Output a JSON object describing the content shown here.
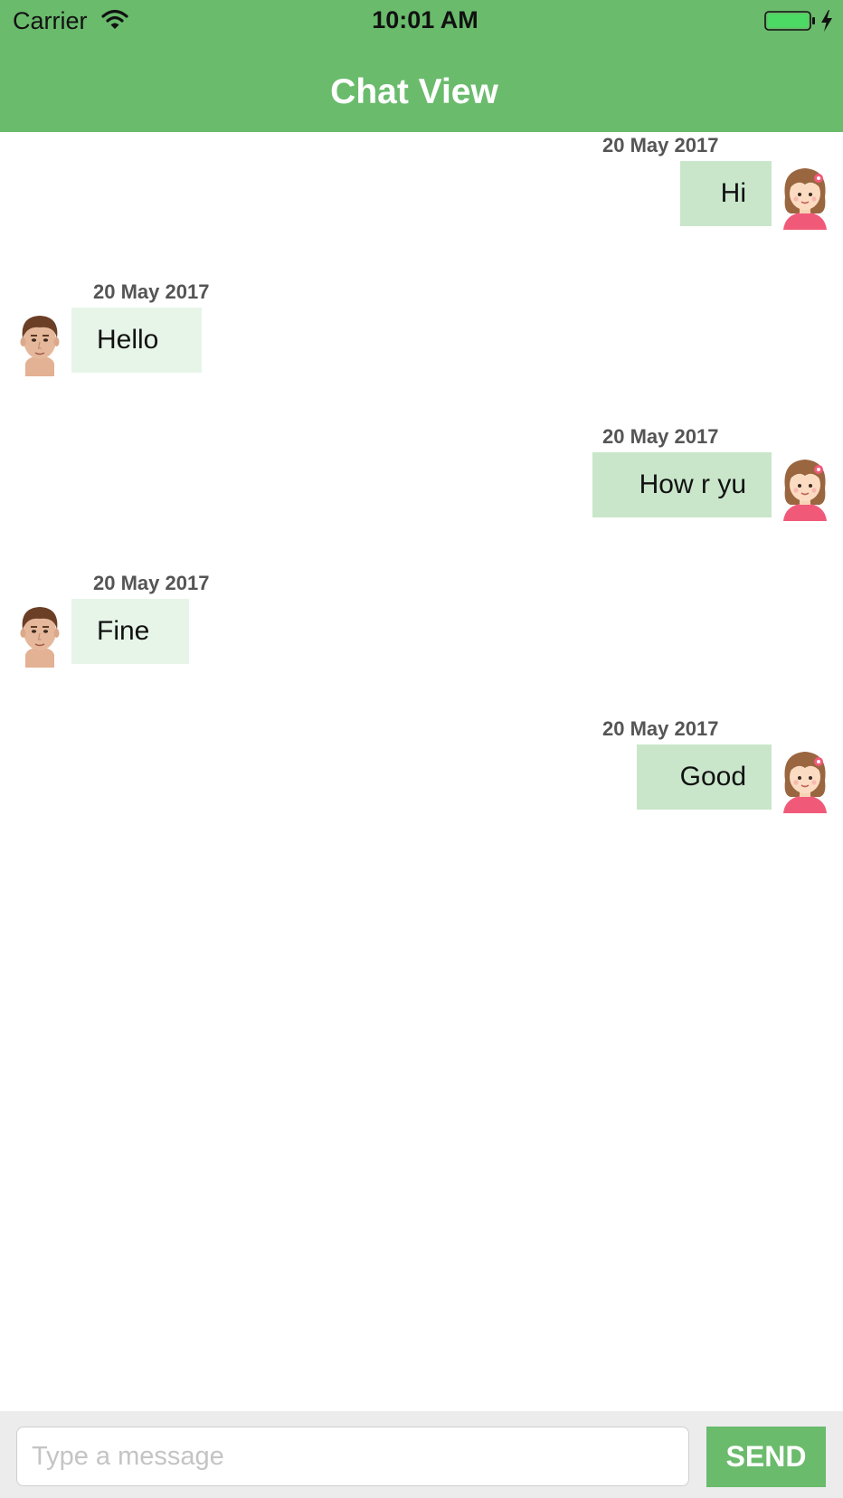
{
  "status_bar": {
    "carrier": "Carrier",
    "time": "10:01 AM"
  },
  "header": {
    "title": "Chat View",
    "background": "#6abb6c"
  },
  "messages": [
    {
      "sender": "female",
      "side": "right",
      "date": "20 May 2017",
      "text": "Hi",
      "avatar": "girl-avatar-icon"
    },
    {
      "sender": "male",
      "side": "left",
      "date": "20 May 2017",
      "text": "Hello",
      "avatar": "boy-avatar-icon"
    },
    {
      "sender": "female",
      "side": "right",
      "date": "20 May 2017",
      "text": "How r yu",
      "avatar": "girl-avatar-icon"
    },
    {
      "sender": "male",
      "side": "left",
      "date": "20 May 2017",
      "text": "Fine",
      "avatar": "boy-avatar-icon"
    },
    {
      "sender": "female",
      "side": "right",
      "date": "20 May 2017",
      "text": "Good",
      "avatar": "girl-avatar-icon"
    }
  ],
  "colors": {
    "sent_bubble": "#c9e6cb",
    "received_bubble": "#e7f5e8",
    "accent": "#6abb6c"
  },
  "composer": {
    "placeholder": "Type a message",
    "value": "",
    "send_label": "SEND"
  }
}
